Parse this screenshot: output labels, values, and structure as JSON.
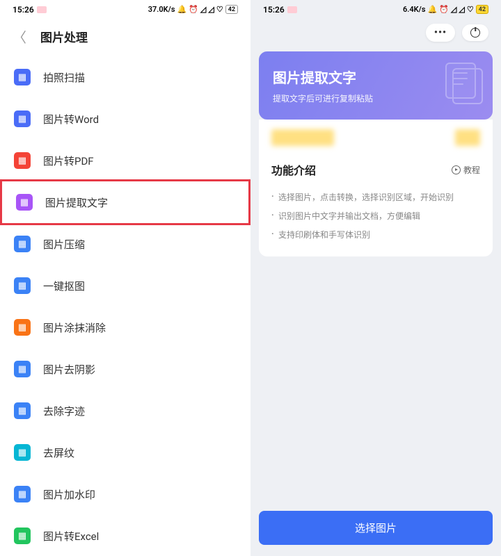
{
  "left": {
    "status": {
      "time": "15:26",
      "speed": "37.0K/s",
      "battery": "42"
    },
    "header": {
      "title": "图片处理"
    },
    "menu": [
      {
        "label": "拍照扫描",
        "icon": "camera-scan-icon",
        "color": "icon-blue"
      },
      {
        "label": "图片转Word",
        "icon": "word-icon",
        "color": "icon-blue"
      },
      {
        "label": "图片转PDF",
        "icon": "pdf-icon",
        "color": "icon-red"
      },
      {
        "label": "图片提取文字",
        "icon": "ocr-icon",
        "color": "icon-purple",
        "highlighted": true
      },
      {
        "label": "图片压缩",
        "icon": "compress-icon",
        "color": "icon-lightblue"
      },
      {
        "label": "一键抠图",
        "icon": "cutout-icon",
        "color": "icon-lightblue"
      },
      {
        "label": "图片涂抹消除",
        "icon": "eraser-icon",
        "color": "icon-orange"
      },
      {
        "label": "图片去阴影",
        "icon": "shadow-icon",
        "color": "icon-lightblue"
      },
      {
        "label": "去除字迹",
        "icon": "remove-text-icon",
        "color": "icon-lightblue"
      },
      {
        "label": "去屏纹",
        "icon": "moire-icon",
        "color": "icon-cyan"
      },
      {
        "label": "图片加水印",
        "icon": "watermark-icon",
        "color": "icon-lightblue"
      },
      {
        "label": "图片转Excel",
        "icon": "excel-icon",
        "color": "icon-green"
      }
    ]
  },
  "right": {
    "status": {
      "time": "15:26",
      "speed": "6.4K/s",
      "battery": "42"
    },
    "hero": {
      "title": "图片提取文字",
      "subtitle": "提取文字后可进行复制粘贴"
    },
    "section": {
      "title": "功能介绍",
      "tutorial": "教程"
    },
    "bullets": [
      "选择图片，点击转换，选择识别区域，开始识别",
      "识别图片中文字并输出文档，方便编辑",
      "支持印刷体和手写体识别"
    ],
    "cta": "选择图片"
  }
}
